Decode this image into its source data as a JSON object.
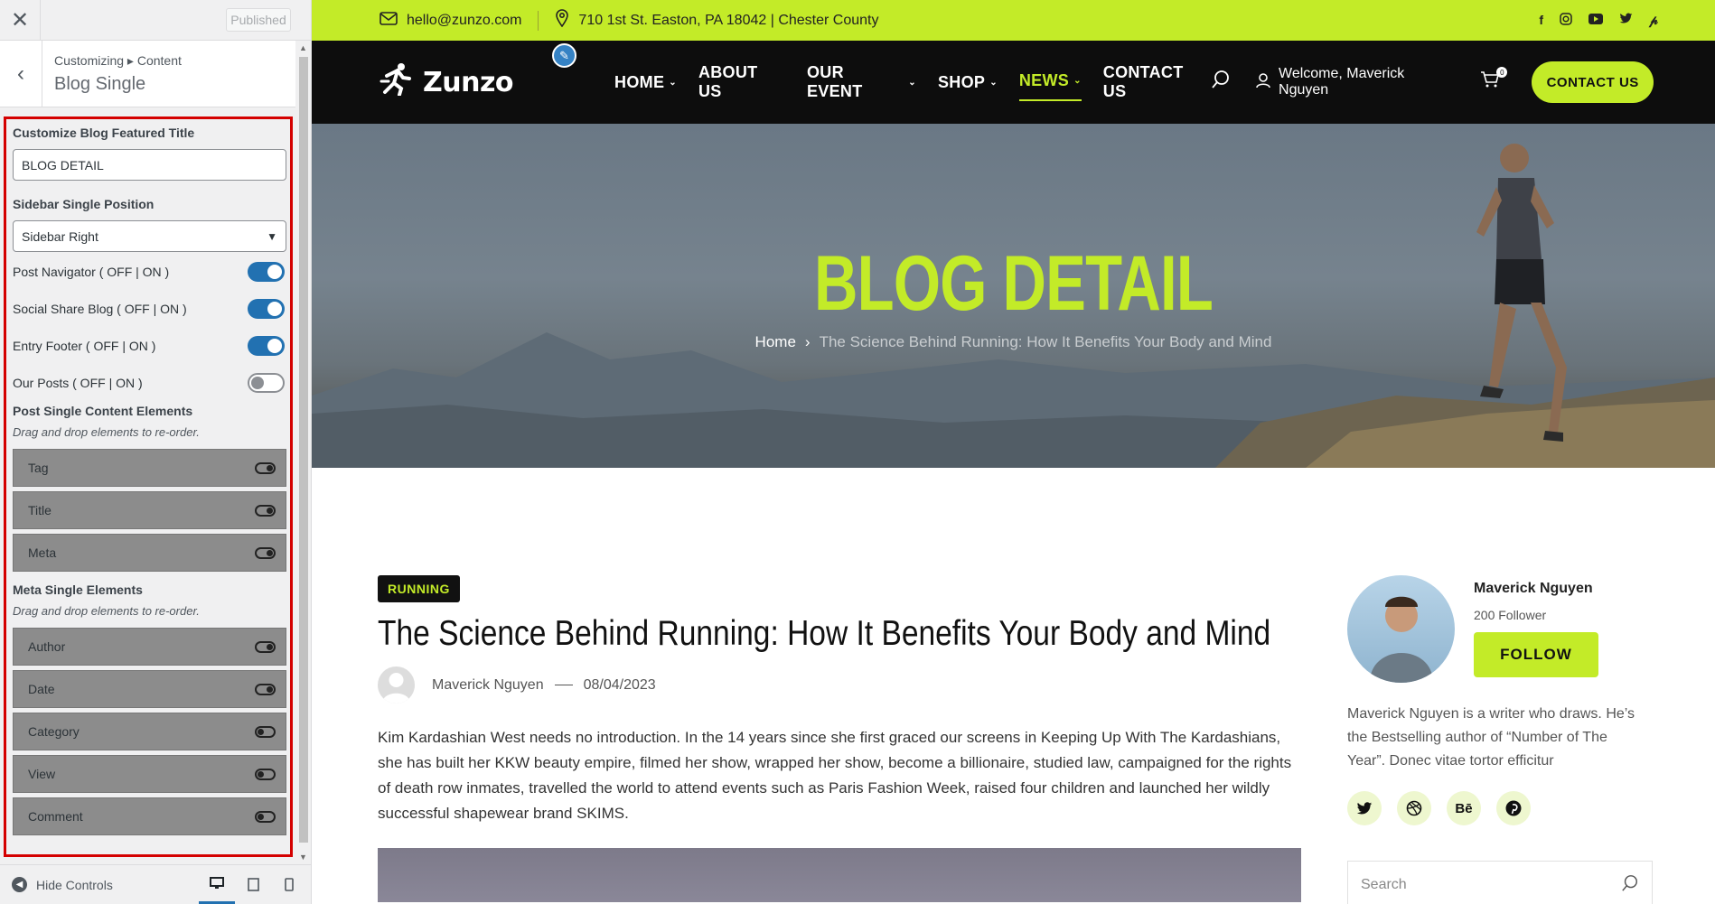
{
  "customizer": {
    "close_icon": "close-icon",
    "publish_label": "Published",
    "breadcrumb": "Customizing ▸ Content",
    "section_title": "Blog Single",
    "featured_title_label": "Customize Blog Featured Title",
    "featured_title_value": "BLOG DETAIL",
    "sidebar_position_label": "Sidebar Single Position",
    "sidebar_position_value": "Sidebar Right",
    "toggles": [
      {
        "label": "Post Navigator ( OFF | ON )",
        "on": true
      },
      {
        "label": "Social Share Blog ( OFF | ON )",
        "on": true
      },
      {
        "label": "Entry Footer ( OFF | ON )",
        "on": true
      },
      {
        "label": "Our Posts ( OFF | ON )",
        "on": false
      }
    ],
    "content_elements_label": "Post Single Content Elements",
    "content_elements_desc": "Drag and drop elements to re-order.",
    "content_elements": [
      {
        "label": "Tag",
        "on": true
      },
      {
        "label": "Title",
        "on": true
      },
      {
        "label": "Meta",
        "on": true
      }
    ],
    "meta_elements_label": "Meta Single Elements",
    "meta_elements_desc": "Drag and drop elements to re-order.",
    "meta_elements": [
      {
        "label": "Author",
        "on": true
      },
      {
        "label": "Date",
        "on": true
      },
      {
        "label": "Category",
        "on": false
      },
      {
        "label": "View",
        "on": false
      },
      {
        "label": "Comment",
        "on": false
      }
    ],
    "hide_controls": "Hide Controls",
    "accent": "#2271b1",
    "highlight_border": "#d40000"
  },
  "site": {
    "email": "hello@zunzo.com",
    "address": "710 1st St. Easton, PA 18042 | Chester County",
    "logo": "Zunzo",
    "menu": [
      "HOME",
      "ABOUT US",
      "OUR EVENT",
      "SHOP",
      "NEWS",
      "CONTACT US"
    ],
    "welcome": "Welcome, Maverick Nguyen",
    "cart_count": "0",
    "contact_btn": "CONTACT US",
    "accent": "#c3eb28",
    "hero": {
      "title": "BLOG DETAIL",
      "crumb_home": "Home",
      "crumb_current": "The Science Behind Running: How It Benefits Your Body and Mind"
    },
    "post": {
      "tag": "RUNNING",
      "title": "The Science Behind Running: How It Benefits Your Body and Mind",
      "author": "Maverick Nguyen",
      "date": "08/04/2023",
      "body": "Kim Kardashian West needs no introduction. In the 14 years since she first graced our screens in Keeping Up With The Kardashians, she has built her KKW beauty empire, filmed her show, wrapped her show, become a billionaire, studied law, campaigned for the rights of death row inmates, travelled the world to attend events such as Paris Fashion Week, raised four children and launched her wildly successful shapewear brand SKIMS."
    },
    "author_box": {
      "name": "Maverick Nguyen",
      "followers": "200 Follower",
      "follow_btn": "FOLLOW",
      "bio": "Maverick Nguyen is a writer who draws. He’s the Bestselling author of “Number of The Year”. Donec vitae tortor efficitur",
      "socials": [
        "twitter-icon",
        "dribbble-icon",
        "behance-icon",
        "pinterest-icon"
      ]
    },
    "search_placeholder": "Search"
  }
}
